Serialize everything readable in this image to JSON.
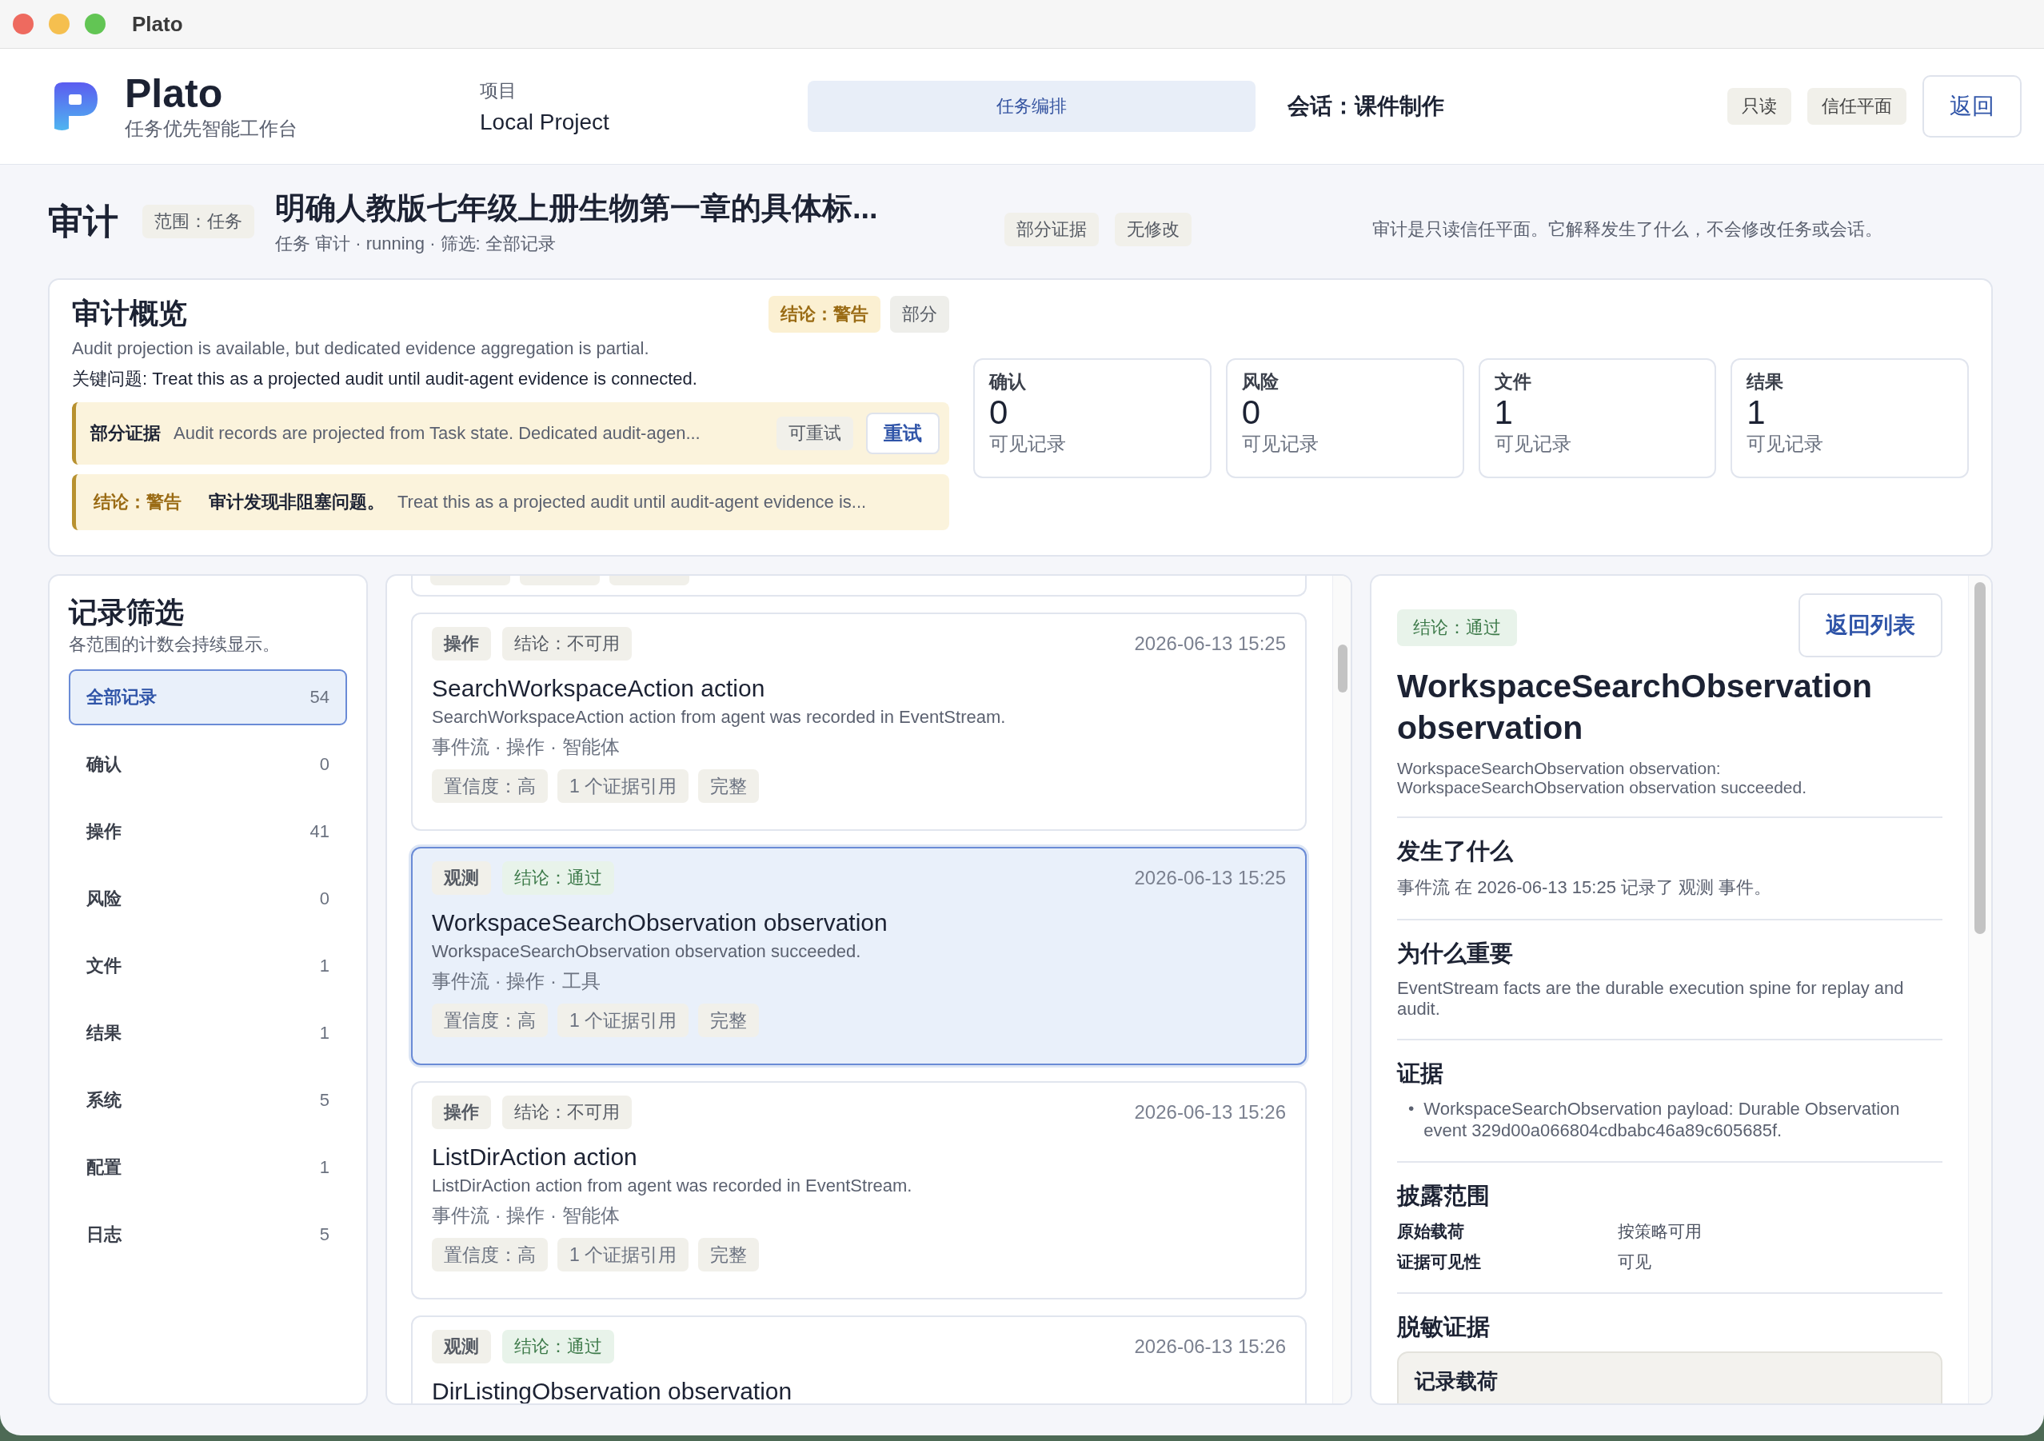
{
  "window": {
    "title": "Plato"
  },
  "header": {
    "app_name": "Plato",
    "app_subtitle": "任务优先智能工作台",
    "project_label": "项目",
    "project_name": "Local Project",
    "center_tab": {
      "label": "任务编排",
      "selected": true
    },
    "session": "会话：课件制作",
    "badges": [
      "只读",
      "信任平面"
    ],
    "back_button": "返回"
  },
  "page": {
    "title": "审计",
    "scope": "范围：任务",
    "task_title": "明确人教版七年级上册生物第一章的具体标...",
    "meta": "任务 审计 · running · 筛选: 全部记录",
    "tags": [
      "部分证据",
      "无修改"
    ],
    "note": "审计是只读信任平面。它解释发生了什么，不会修改任务或会话。"
  },
  "overview": {
    "title": "审计概览",
    "badges": [
      {
        "label": "结论：警告",
        "kind": "warning"
      },
      {
        "label": "部分",
        "kind": "neutral"
      }
    ],
    "description": "Audit projection is available, but dedicated evidence aggregation is partial.",
    "key_issue": "关键问题: Treat this as a projected audit until audit-agent evidence is connected.",
    "alerts": [
      {
        "kind": "partial",
        "label": "部分证据",
        "text": "Audit records are projected from Task state. Dedicated audit-agen...",
        "status": "可重试",
        "button": "重试"
      },
      {
        "kind": "verdict",
        "label": "结论：警告",
        "headline": "审计发现非阻塞问题。",
        "text": "Treat this as a projected audit until audit-agent evidence is..."
      }
    ],
    "stats": [
      {
        "label": "确认",
        "value": "0",
        "caption": "可见记录"
      },
      {
        "label": "风险",
        "value": "0",
        "caption": "可见记录"
      },
      {
        "label": "文件",
        "value": "1",
        "caption": "可见记录"
      },
      {
        "label": "结果",
        "value": "1",
        "caption": "可见记录"
      }
    ]
  },
  "filters": {
    "title": "记录筛选",
    "subtitle": "各范围的计数会持续显示。",
    "items": [
      {
        "label": "全部记录",
        "count": "54",
        "selected": true
      },
      {
        "label": "确认",
        "count": "0",
        "selected": false
      },
      {
        "label": "操作",
        "count": "41",
        "selected": false
      },
      {
        "label": "风险",
        "count": "0",
        "selected": false
      },
      {
        "label": "文件",
        "count": "1",
        "selected": false
      },
      {
        "label": "结果",
        "count": "1",
        "selected": false
      },
      {
        "label": "系统",
        "count": "5",
        "selected": false
      },
      {
        "label": "配置",
        "count": "1",
        "selected": false
      },
      {
        "label": "日志",
        "count": "5",
        "selected": false
      }
    ]
  },
  "records": [
    {
      "type_tag": "操作",
      "verdict": {
        "label": "结论：不可用",
        "kind": "unavailable"
      },
      "time": "2026-06-13 15:25",
      "title": "SearchWorkspaceAction action",
      "summary": "SearchWorkspaceAction action from agent was recorded in EventStream.",
      "meta": "事件流 · 操作 · 智能体",
      "pills": [
        "置信度：高",
        "1 个证据引用",
        "完整"
      ],
      "selected": false
    },
    {
      "type_tag": "观测",
      "verdict": {
        "label": "结论：通过",
        "kind": "pass"
      },
      "time": "2026-06-13 15:25",
      "title": "WorkspaceSearchObservation observation",
      "summary": "WorkspaceSearchObservation observation succeeded.",
      "meta": "事件流 · 操作 · 工具",
      "pills": [
        "置信度：高",
        "1 个证据引用",
        "完整"
      ],
      "selected": true
    },
    {
      "type_tag": "操作",
      "verdict": {
        "label": "结论：不可用",
        "kind": "unavailable"
      },
      "time": "2026-06-13 15:26",
      "title": "ListDirAction action",
      "summary": "ListDirAction action from agent was recorded in EventStream.",
      "meta": "事件流 · 操作 · 智能体",
      "pills": [
        "置信度：高",
        "1 个证据引用",
        "完整"
      ],
      "selected": false
    },
    {
      "type_tag": "观测",
      "verdict": {
        "label": "结论：通过",
        "kind": "pass"
      },
      "time": "2026-06-13 15:26",
      "title": "DirListingObservation observation",
      "selected": false
    }
  ],
  "detail": {
    "verdict": {
      "label": "结论：通过",
      "kind": "pass"
    },
    "back_button": "返回列表",
    "title": "WorkspaceSearchObservation observation",
    "summary": "WorkspaceSearchObservation observation: WorkspaceSearchObservation observation succeeded.",
    "sections": [
      {
        "kind": "text",
        "heading": "发生了什么",
        "text": "事件流 在 2026-06-13 15:25 记录了 观测 事件。"
      },
      {
        "kind": "text",
        "heading": "为什么重要",
        "text": "EventStream facts are the durable execution spine for replay and audit."
      },
      {
        "kind": "list",
        "heading": "证据",
        "items": [
          {
            "bullet": "•",
            "text": "WorkspaceSearchObservation payload: Durable Observation event 329d00a066804cdbabc46a89c605685f."
          }
        ]
      },
      {
        "kind": "pairs",
        "heading": "披露范围",
        "rows": [
          {
            "key": "原始载荷",
            "value": "按策略可用"
          },
          {
            "key": "证据可见性",
            "value": "可见"
          }
        ]
      },
      {
        "kind": "boxes",
        "heading": "脱敏证据",
        "boxes": [
          "记录载荷"
        ]
      }
    ]
  }
}
